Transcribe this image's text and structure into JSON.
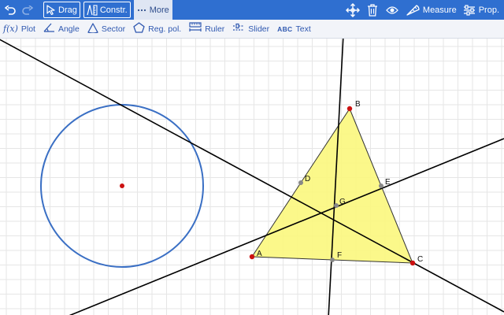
{
  "toolbar": {
    "drag_label": "Drag",
    "construct_label": "Constr.",
    "more_label": "More",
    "measure_label": "Measure",
    "properties_label": "Prop."
  },
  "subtoolbar": {
    "plot_label": "Plot",
    "angle_label": "Angle",
    "sector_label": "Sector",
    "regular_polygon_label": "Reg. pol.",
    "ruler_label": "Ruler",
    "slider_label": "Slider",
    "text_icon_label": "ABC",
    "text_label": "Text"
  },
  "icons": {
    "undo": "undo-icon",
    "redo": "redo-icon",
    "drag": "cursor-arrow-icon",
    "construct": "compass-ruler-icon",
    "more": "ellipsis-icon",
    "move": "move-arrows-icon",
    "delete": "trash-icon",
    "visibility": "eye-icon",
    "measure": "protractor-icon",
    "properties": "sliders-icon",
    "plot": "function-icon",
    "angle": "angle-icon",
    "sector": "sector-icon",
    "regular_polygon": "pentagon-icon",
    "ruler": "ruler-icon",
    "slider": "slider-icon"
  },
  "points": {
    "A": "A",
    "B": "B",
    "C": "C",
    "D": "D",
    "E": "E",
    "F": "F",
    "G": "G"
  },
  "colors": {
    "toolbar": "#2f6fd0",
    "subtoolbar_text": "#2f58b0",
    "triangle_fill": "#fbf77d",
    "circle_stroke": "#3a6fc4",
    "point_red": "#cc1111",
    "point_gray": "#888888",
    "grid": "#e6e6e6"
  }
}
